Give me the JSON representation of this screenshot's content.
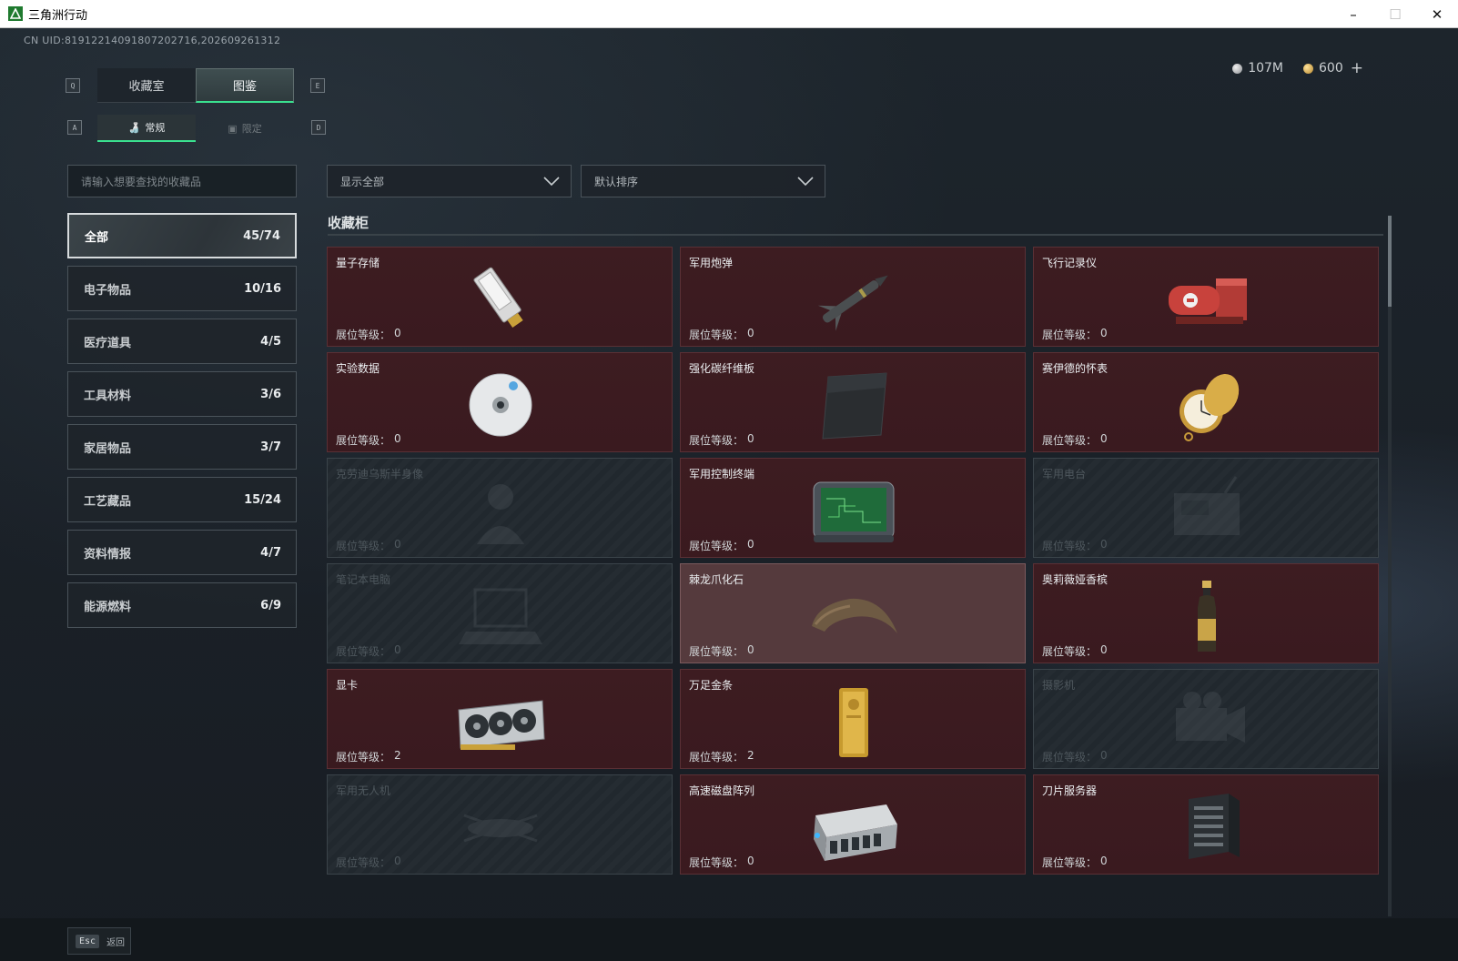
{
  "window": {
    "title": "三角洲行动",
    "controls": {
      "minimize": "–",
      "maximize": "☐",
      "close": "✕"
    }
  },
  "account": {
    "uid": "CN UID:8191221409180720271​6,20260926131​2"
  },
  "currency": {
    "silver": "107M",
    "gold": "600",
    "add": "+"
  },
  "hotkeys": {
    "tab_prev": "Q",
    "tab_next": "E",
    "sub_prev": "A",
    "sub_next": "D"
  },
  "tabs": [
    {
      "label": "收藏室",
      "active": false
    },
    {
      "label": "图鉴",
      "active": true
    }
  ],
  "subtabs": [
    {
      "label": "常规",
      "icon": "bottle-icon",
      "active": true
    },
    {
      "label": "限定",
      "icon": "frame-icon",
      "active": false
    }
  ],
  "search": {
    "placeholder": "请输入想要查找的收藏品",
    "value": ""
  },
  "filters": {
    "filter_label": "显示全部",
    "sort_label": "默认排序"
  },
  "categories": [
    {
      "label": "全部",
      "count": "45/74",
      "active": true
    },
    {
      "label": "电子物品",
      "count": "10/16"
    },
    {
      "label": "医疗道具",
      "count": "4/5"
    },
    {
      "label": "工具材料",
      "count": "3/6"
    },
    {
      "label": "家居物品",
      "count": "3/7"
    },
    {
      "label": "工艺藏品",
      "count": "15/24"
    },
    {
      "label": "资料情报",
      "count": "4/7"
    },
    {
      "label": "能源燃料",
      "count": "6/9"
    }
  ],
  "section_title": "收藏柜",
  "level_label": "展位等级：",
  "items": [
    {
      "name": "量子存储",
      "level": "0",
      "state": "owned",
      "icon": "usb-drive-icon"
    },
    {
      "name": "军用炮弹",
      "level": "0",
      "state": "owned",
      "icon": "missile-icon"
    },
    {
      "name": "飞行记录仪",
      "level": "0",
      "state": "owned",
      "icon": "flight-recorder-icon"
    },
    {
      "name": "实验数据",
      "level": "0",
      "state": "owned",
      "icon": "disc-icon"
    },
    {
      "name": "强化碳纤维板",
      "level": "0",
      "state": "owned",
      "icon": "carbon-plate-icon"
    },
    {
      "name": "赛伊德的怀表",
      "level": "0",
      "state": "owned",
      "icon": "pocket-watch-icon"
    },
    {
      "name": "克劳迪乌斯半身像",
      "level": "0",
      "state": "locked",
      "icon": "bust-icon"
    },
    {
      "name": "军用控制终端",
      "level": "0",
      "state": "owned",
      "icon": "control-terminal-icon"
    },
    {
      "name": "军用电台",
      "level": "0",
      "state": "locked",
      "icon": "radio-icon"
    },
    {
      "name": "笔记本电脑",
      "level": "0",
      "state": "locked",
      "icon": "laptop-icon"
    },
    {
      "name": "棘龙爪化石",
      "level": "0",
      "state": "highlight",
      "icon": "claw-fossil-icon"
    },
    {
      "name": "奥莉薇娅香槟",
      "level": "0",
      "state": "owned",
      "icon": "champagne-icon"
    },
    {
      "name": "显卡",
      "level": "2",
      "state": "owned",
      "icon": "graphics-card-icon"
    },
    {
      "name": "万足金条",
      "level": "2",
      "state": "owned",
      "icon": "gold-bar-icon"
    },
    {
      "name": "摄影机",
      "level": "0",
      "state": "locked",
      "icon": "camera-icon"
    },
    {
      "name": "军用无人机",
      "level": "0",
      "state": "locked",
      "icon": "drone-icon"
    },
    {
      "name": "高速磁盘阵列",
      "level": "0",
      "state": "owned",
      "icon": "disk-array-icon"
    },
    {
      "name": "刀片服务器",
      "level": "0",
      "state": "owned",
      "icon": "blade-server-icon"
    }
  ],
  "footer": {
    "key": "Esc",
    "label": "返回"
  },
  "colors": {
    "accent": "#3ae08f",
    "owned_card": "#3d1c21",
    "highlight_card": "#553a3d",
    "locked_card": "#21282e"
  }
}
